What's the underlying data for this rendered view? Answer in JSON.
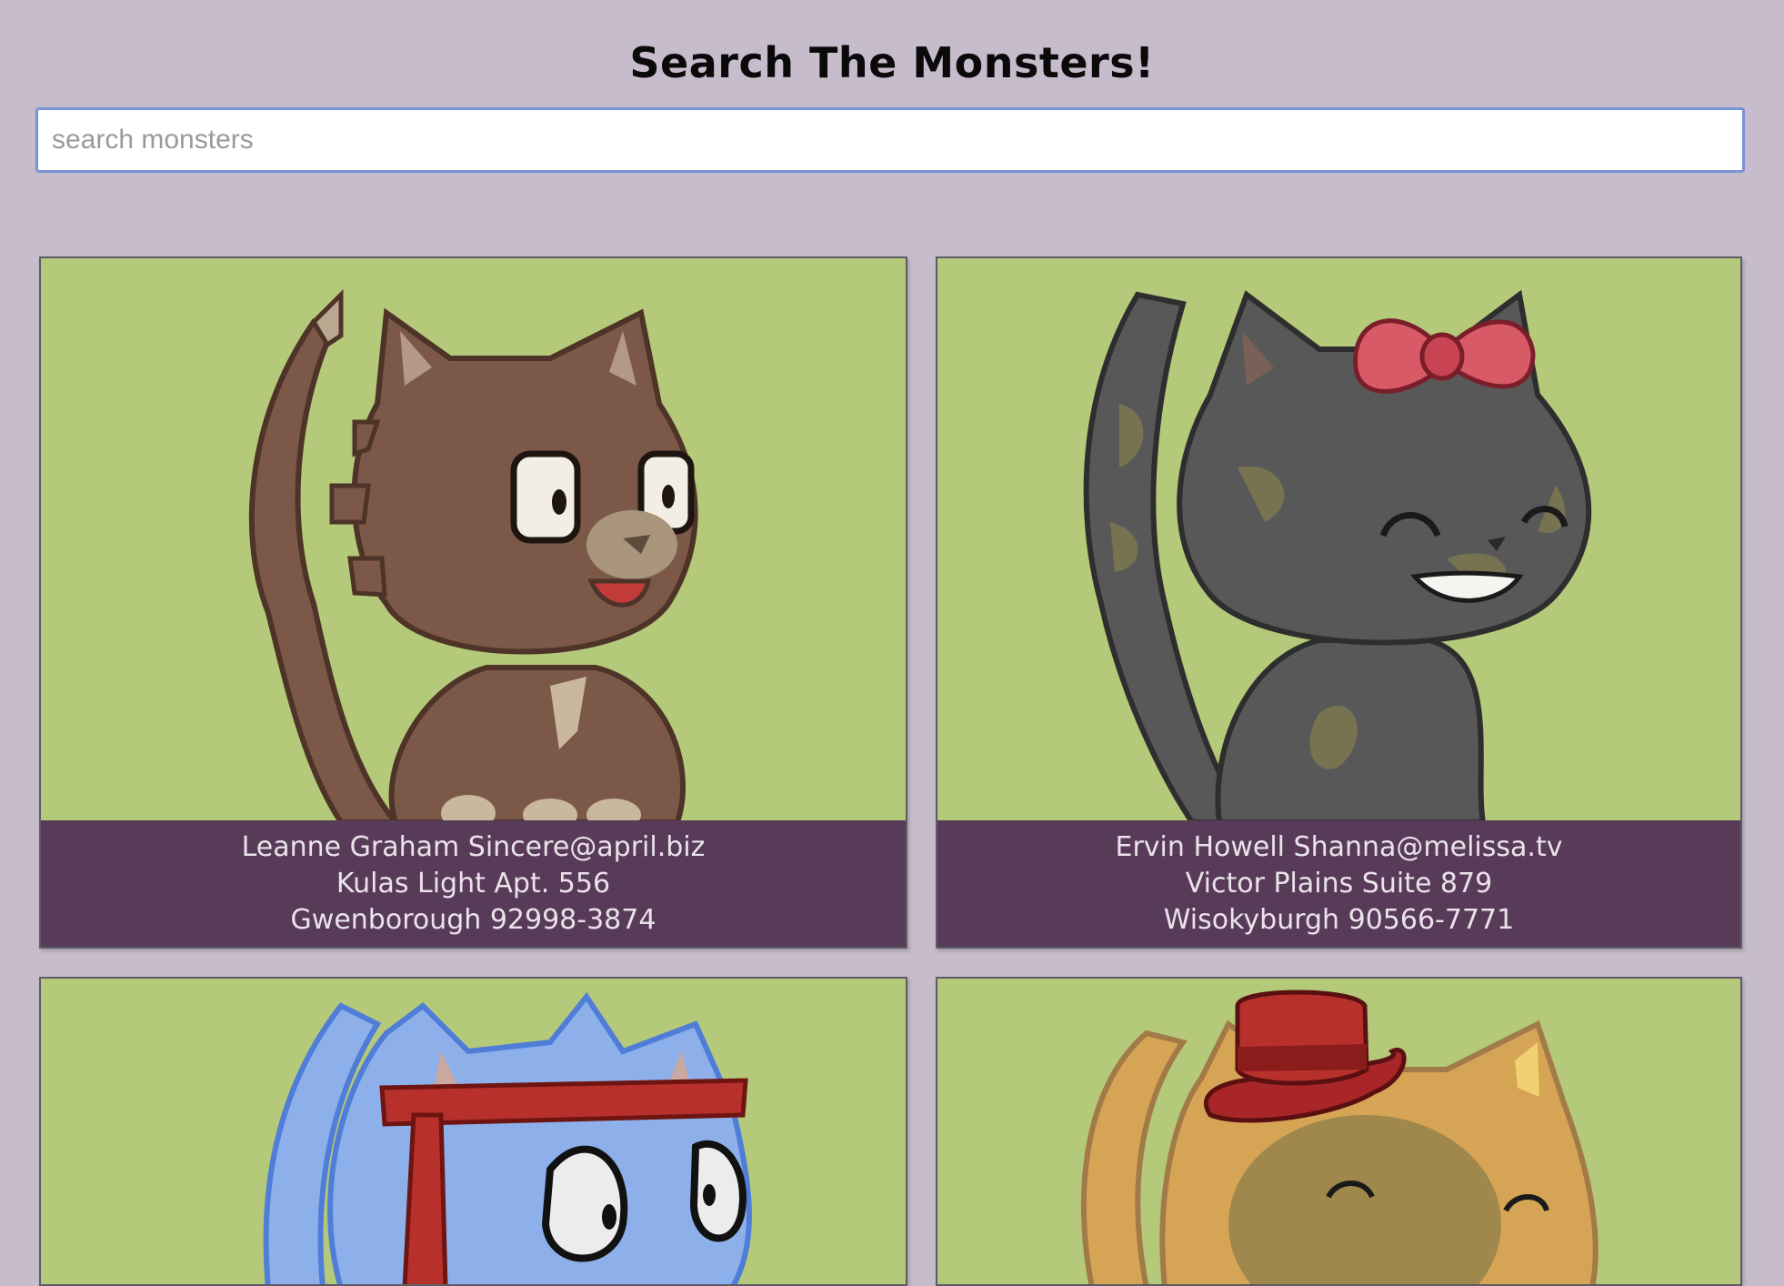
{
  "page": {
    "title": "Search The Monsters!"
  },
  "search": {
    "placeholder": "search monsters",
    "value": ""
  },
  "colors": {
    "background": "#c6bccb",
    "card_image_bg": "#b4c979",
    "caption_bg": "#583b58",
    "search_border": "#7b93d6"
  },
  "monsters": [
    {
      "name": "Leanne Graham",
      "email": "Sincere@april.biz",
      "street_suite": "Kulas Light Apt. 556",
      "city_zip": "Gwenborough 92998-3874",
      "line1": "Leanne Graham Sincere@april.biz",
      "line2": "Kulas Light Apt. 556",
      "line3": "Gwenborough 92998-3874",
      "image": "brown-cat"
    },
    {
      "name": "Ervin Howell",
      "email": "Shanna@melissa.tv",
      "street_suite": "Victor Plains Suite 879",
      "city_zip": "Wisokyburgh 90566-7771",
      "line1": "Ervin Howell Shanna@melissa.tv",
      "line2": "Victor Plains Suite 879",
      "line3": "Wisokyburgh 90566-7771",
      "image": "black-cat-with-bow"
    },
    {
      "image": "blue-cat-with-headband"
    },
    {
      "image": "orange-cat-with-hat"
    }
  ]
}
